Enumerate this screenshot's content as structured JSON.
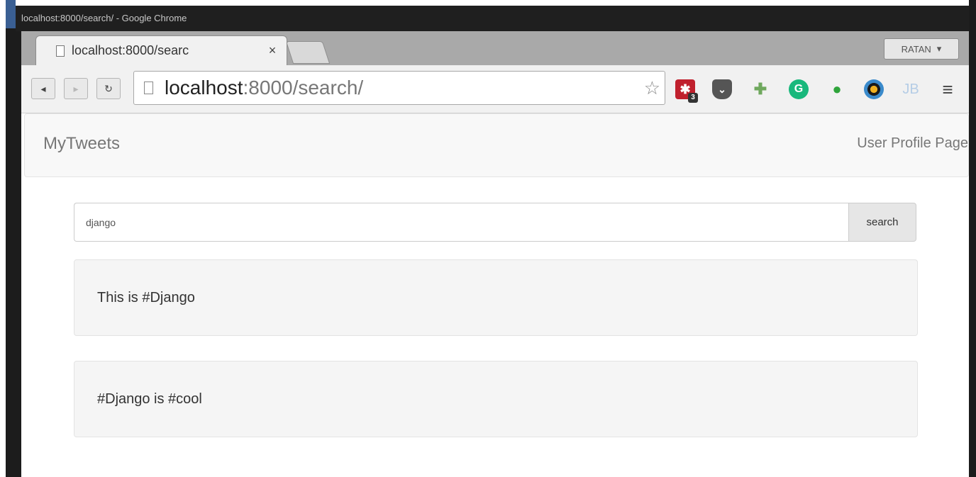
{
  "window": {
    "title": "localhost:8000/search/ - Google Chrome"
  },
  "tabs": [
    {
      "label": "localhost:8000/searc",
      "close": "×"
    }
  ],
  "user_button": {
    "label": "RATAN",
    "caret": "▾"
  },
  "toolbar": {
    "back_icon": "◂",
    "forward_icon": "▸",
    "reload_icon": "↻",
    "url_host": "localhost",
    "url_path": ":8000/search/",
    "star_icon": "☆",
    "extensions": [
      {
        "name": "todoist",
        "glyph": "✱",
        "badge": "3"
      },
      {
        "name": "pocket",
        "glyph": "⌄"
      },
      {
        "name": "puzzle",
        "glyph": "✚"
      },
      {
        "name": "grammarly",
        "glyph": "G"
      },
      {
        "name": "evernote",
        "glyph": "●"
      },
      {
        "name": "color-wheel",
        "glyph": ""
      },
      {
        "name": "jetbrains",
        "glyph": "JB"
      }
    ],
    "menu_icon": "≡"
  },
  "navbar": {
    "brand": "MyTweets",
    "link": "User Profile Page"
  },
  "search": {
    "value": "django",
    "button": "search"
  },
  "tweets": [
    {
      "text": "This is #Django"
    },
    {
      "text": "#Django is #cool"
    }
  ]
}
